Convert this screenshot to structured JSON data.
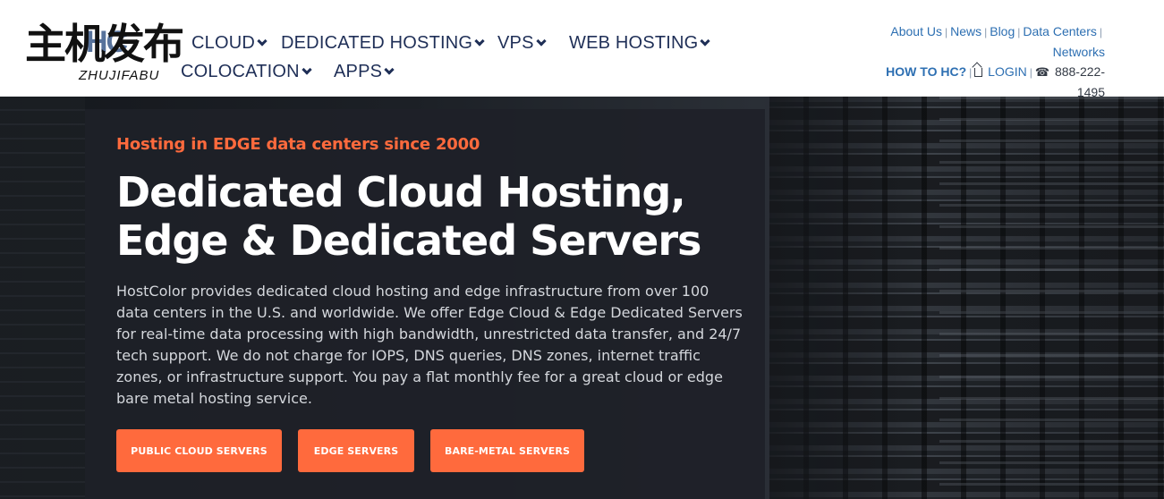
{
  "logo": {
    "brand_letters": "HC",
    "cn_text": "主机发布",
    "en_text": "ZHUJIFABU"
  },
  "nav": {
    "items": [
      {
        "label": "CLOUD"
      },
      {
        "label": "DEDICATED HOSTING"
      },
      {
        "label": "VPS"
      },
      {
        "label": "WEB HOSTING"
      },
      {
        "label": "COLOCATION"
      },
      {
        "label": "APPS"
      }
    ]
  },
  "toplinks": {
    "about": "About Us",
    "news": "News",
    "blog": "Blog",
    "datacenters": "Data Centers",
    "networks": "Networks",
    "howto": "HOW TO HC?",
    "login": "LOGIN",
    "phone": "888-222-1495"
  },
  "hero": {
    "eyebrow": "Hosting in EDGE data centers since 2000",
    "headline_line1": "Dedicated Cloud Hosting,",
    "headline_line2": "Edge & Dedicated Servers",
    "description": "HostColor provides dedicated cloud hosting and edge infrastructure from over 100 data centers in the U.S. and worldwide. We offer Edge Cloud & Edge Dedicated Servers for real-time data processing with high bandwidth, unrestricted data transfer, and 24/7 tech support. We do not charge for IOPS, DNS queries, DNS zones, internet traffic zones, or infrastructure support. You pay a flat monthly fee for a great cloud or edge bare metal hosting service.",
    "buttons": [
      {
        "label": "PUBLIC CLOUD SERVERS"
      },
      {
        "label": "EDGE SERVERS"
      },
      {
        "label": "BARE-METAL SERVERS"
      }
    ]
  },
  "colors": {
    "accent": "#ff6a3d",
    "nav_text": "#1f2f57",
    "link": "#2d6fb2"
  }
}
